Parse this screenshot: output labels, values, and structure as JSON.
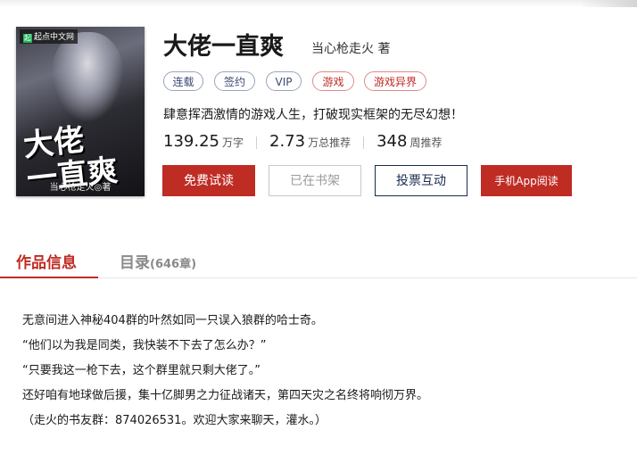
{
  "book": {
    "title": "大佬一直爽",
    "author": "当心枪走火",
    "author_suffix": "著",
    "tags": [
      "连载",
      "签约",
      "VIP",
      "游戏",
      "游戏异界"
    ],
    "intro": "肆意挥洒激情的游戏人生，打破现实框架的无尽幻想！",
    "stats": [
      {
        "value": "139.25",
        "unit": "万字"
      },
      {
        "value": "2.73",
        "unit": "万总推荐"
      },
      {
        "value": "348",
        "unit": "周推荐"
      }
    ]
  },
  "cover": {
    "logo_mark": "起",
    "logo_text": "起点中文网",
    "title_line1": "大佬",
    "title_line2": "一直爽",
    "author_text": "当心枪走火◎著"
  },
  "actions": {
    "free_read": "免费试读",
    "on_shelf": "已在书架",
    "vote": "投票互动",
    "app_read": "手机App阅读"
  },
  "tabs": {
    "info": "作品信息",
    "catalog": "目录",
    "catalog_count": "(646章)"
  },
  "description": [
    "无意间进入神秘404群的叶然如同一只误入狼群的哈士奇。",
    "“他们以为我是同类，我快装不下去了怎么办？”",
    "“只要我这一枪下去，这个群里就只剩大佬了。”",
    "还好咱有地球做后援，集十亿脚男之力征战诸天，第四天灾之名终将响彻万界。",
    "（走火的书友群：874026531。欢迎大家来聊天，灌水。）"
  ],
  "colors": {
    "accent": "#bf2c24",
    "tag_blue": "#3a4a73",
    "vote_blue": "#1a2b52"
  }
}
